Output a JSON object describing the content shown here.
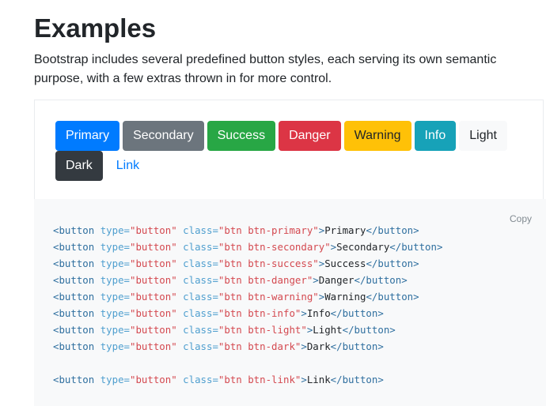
{
  "heading": {
    "title": "Examples",
    "lead": "Bootstrap includes several predefined button styles, each serving its own semantic purpose, with a few extras thrown in for more control."
  },
  "example": {
    "buttons": {
      "primary": "Primary",
      "secondary": "Secondary",
      "success": "Success",
      "danger": "Danger",
      "warning": "Warning",
      "info": "Info",
      "light": "Light",
      "dark": "Dark",
      "link": "Link"
    }
  },
  "code": {
    "copy_label": "Copy",
    "tag_open": "<button",
    "attr_type": "type=",
    "val_type": "\"button\"",
    "attr_class": "class=",
    "tag_close_open": ">",
    "tag_end": "</button>",
    "lines": [
      {
        "class_value": "\"btn btn-primary\"",
        "text": "Primary"
      },
      {
        "class_value": "\"btn btn-secondary\"",
        "text": "Secondary"
      },
      {
        "class_value": "\"btn btn-success\"",
        "text": "Success"
      },
      {
        "class_value": "\"btn btn-danger\"",
        "text": "Danger"
      },
      {
        "class_value": "\"btn btn-warning\"",
        "text": "Warning"
      },
      {
        "class_value": "\"btn btn-info\"",
        "text": "Info"
      },
      {
        "class_value": "\"btn btn-light\"",
        "text": "Light"
      },
      {
        "class_value": "\"btn btn-dark\"",
        "text": "Dark"
      },
      {
        "class_value": "\"btn btn-link\"",
        "text": "Link"
      }
    ]
  },
  "colors": {
    "primary": "#007bff",
    "secondary": "#6c757d",
    "success": "#28a745",
    "danger": "#dc3545",
    "warning": "#ffc107",
    "info": "#17a2b8",
    "light": "#f8f9fa",
    "dark": "#343a40",
    "code_background": "#f8f9fa"
  }
}
